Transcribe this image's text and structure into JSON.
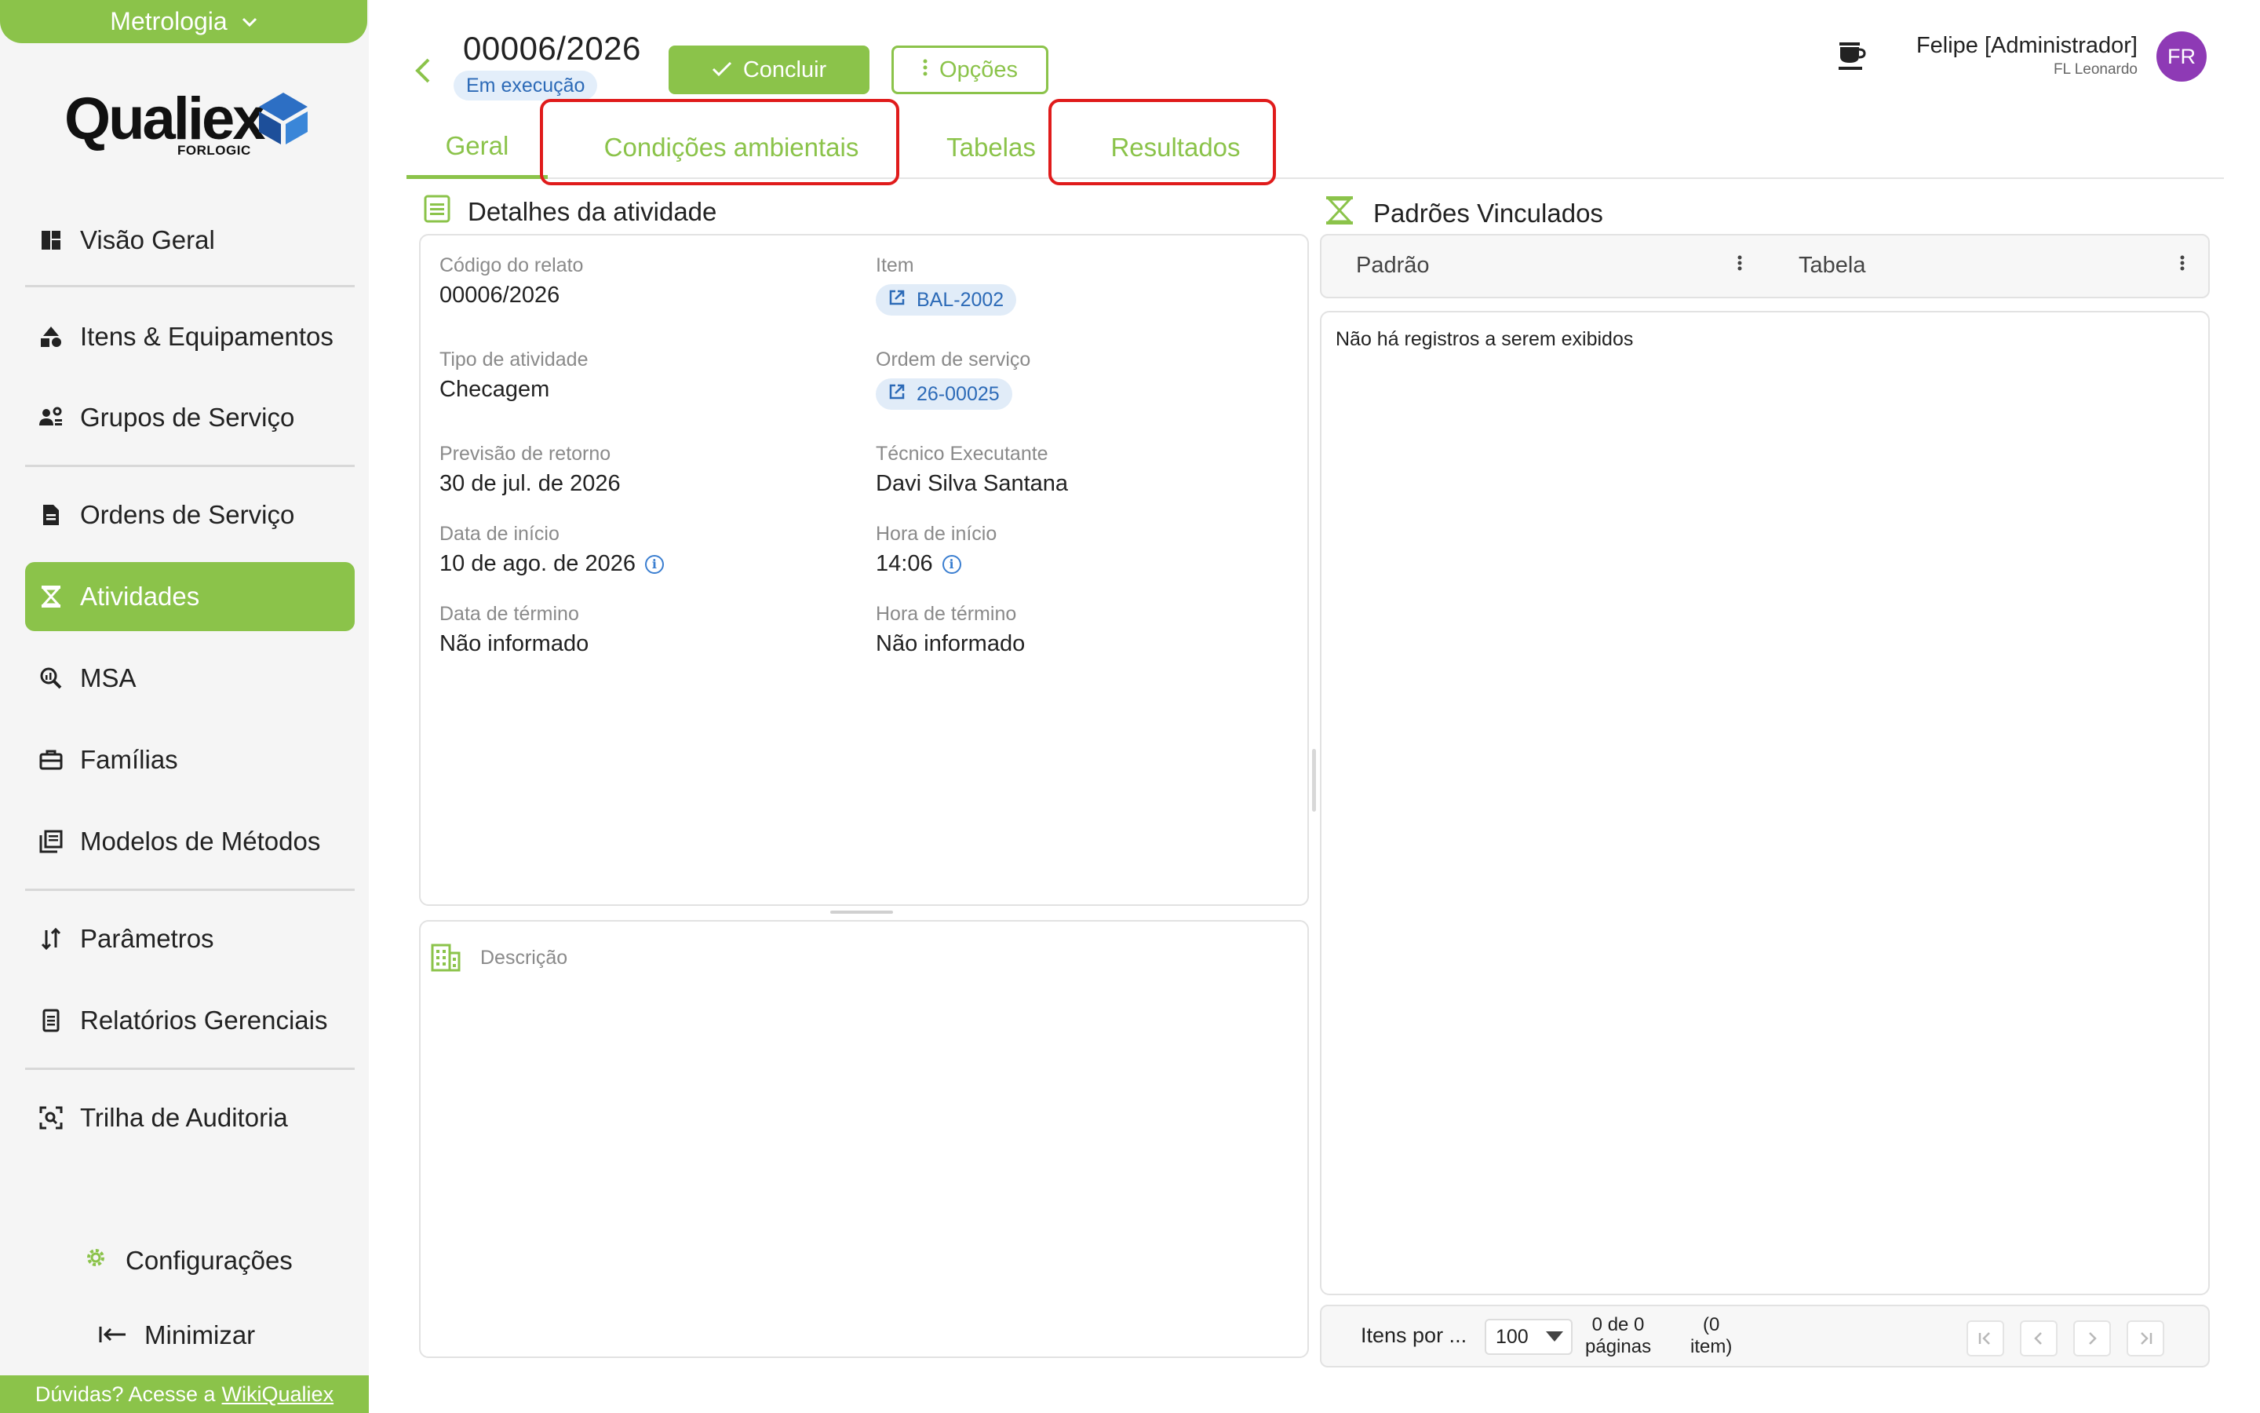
{
  "module": {
    "label": "Metrologia"
  },
  "logo": {
    "word": "Qualiex",
    "sub": "FORLOGIC"
  },
  "sidebar": {
    "items": [
      {
        "label": "Visão Geral",
        "icon": "dashboard-icon"
      },
      {
        "label": "Itens & Equipamentos",
        "icon": "shapes-icon"
      },
      {
        "label": "Grupos de Serviço",
        "icon": "people-gear-icon"
      },
      {
        "label": "Ordens de Serviço",
        "icon": "document-icon"
      },
      {
        "label": "Atividades",
        "icon": "hourglass-icon",
        "active": true
      },
      {
        "label": "MSA",
        "icon": "magnify-chart-icon"
      },
      {
        "label": "Famílias",
        "icon": "toolbox-icon"
      },
      {
        "label": "Modelos de Métodos",
        "icon": "library-icon"
      },
      {
        "label": "Parâmetros",
        "icon": "sort-arrows-icon"
      },
      {
        "label": "Relatórios Gerenciais",
        "icon": "report-icon"
      },
      {
        "label": "Trilha de Auditoria",
        "icon": "scan-icon"
      }
    ],
    "settings_label": "Configurações",
    "minimize_label": "Minimizar",
    "help_text": "Dúvidas? Acesse a",
    "help_link": "WikiQualiex"
  },
  "header": {
    "title": "00006/2026",
    "status": "Em execução",
    "conclude_label": "Concluir",
    "options_label": "Opções",
    "user_name": "Felipe [Administrador]",
    "user_company": "FL Leonardo",
    "avatar_initials": "FR"
  },
  "tabs": [
    {
      "label": "Geral",
      "active": true
    },
    {
      "label": "Condições ambientais"
    },
    {
      "label": "Tabelas"
    },
    {
      "label": "Resultados"
    }
  ],
  "details": {
    "section_title": "Detalhes da atividade",
    "fields": {
      "report_code_label": "Código do relato",
      "report_code_value": "00006/2026",
      "item_label": "Item",
      "item_value": "BAL-2002",
      "activity_type_label": "Tipo de atividade",
      "activity_type_value": "Checagem",
      "service_order_label": "Ordem de serviço",
      "service_order_value": "26-00025",
      "return_forecast_label": "Previsão de retorno",
      "return_forecast_value": "30 de jul. de 2026",
      "technician_label": "Técnico Executante",
      "technician_value": "Davi Silva Santana",
      "start_date_label": "Data de início",
      "start_date_value": "10 de ago. de 2026",
      "start_time_label": "Hora de início",
      "start_time_value": "14:06",
      "end_date_label": "Data de término",
      "end_date_value": "Não informado",
      "end_time_label": "Hora de término",
      "end_time_value": "Não informado"
    },
    "description_label": "Descrição"
  },
  "standards": {
    "section_title": "Padrões Vinculados",
    "columns": [
      "Padrão",
      "Tabela"
    ],
    "empty_message": "Não há registros a serem exibidos",
    "pager": {
      "items_per_page_label": "Itens por ...",
      "page_size": "100",
      "count_line1": "0 de 0",
      "count_line2": "páginas",
      "items_line1": "(0",
      "items_line2": "item)"
    }
  },
  "colors": {
    "accent": "#8bc34a",
    "highlight": "#e01b1b",
    "chip_bg": "#e1ecf8",
    "avatar": "#8e3ab5"
  }
}
